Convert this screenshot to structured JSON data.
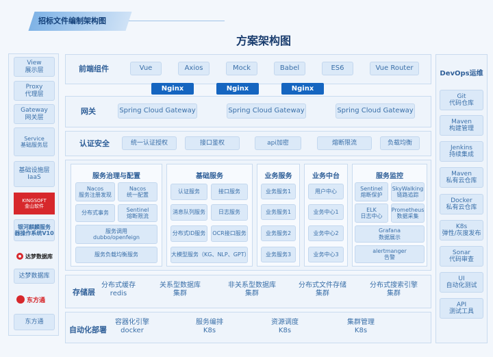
{
  "header": {
    "tab_title": "招标文件编制架构图",
    "main_title": "方案架构图"
  },
  "left_column": {
    "view": "View\n展示层",
    "proxy": "Proxy\n代理层",
    "gateway": "Gateway\n网关层",
    "service": "Service\n基础服务层",
    "iaas": "基础设施层\nIaaS",
    "kingsoft_logo": "KINGSOFT\n金山软件",
    "kylin_os": "银河麒麟服务\n器操作系统V10",
    "dameng_logo": "达梦数据库",
    "dameng": "达梦数据库",
    "dongfangtong_logo": "东方通",
    "dongfangtong": "东方通"
  },
  "frontend": {
    "label": "前端组件",
    "items": [
      "Vue",
      "Axios",
      "Mock",
      "Babel",
      "ES6",
      "Vue Router"
    ]
  },
  "nginx": [
    "Nginx",
    "Nginx",
    "Nginx"
  ],
  "gateway_row": {
    "label": "网关",
    "items": [
      "Spring Cloud Gateway",
      "Spring Cloud Gateway",
      "Spring Cloud Gateway"
    ]
  },
  "auth_row": {
    "label": "认证安全",
    "items": [
      "统一认证授权",
      "接口鉴权",
      "api加密",
      "熔断限流",
      "负载均衡"
    ]
  },
  "governance": {
    "title": "服务治理与配置",
    "items": [
      "Nacos\n服务注册发现",
      "Nacos\n统一配置",
      "分布式事务",
      "Sentinel\n熔断限流",
      "服务调用\ndubbo/openfeign",
      "服务负载均衡服务"
    ]
  },
  "basic": {
    "title": "基础服务",
    "items": [
      "认证服务",
      "接口服务",
      "消息队列服务",
      "日志服务",
      "分布式ID服务",
      "OCR接口服务",
      "大模型服务（KG、NLP、GPT）"
    ]
  },
  "business": {
    "title": "业务服务",
    "items": [
      "业务服务1",
      "业务服务1",
      "业务服务2",
      "业务服务3"
    ]
  },
  "middle": {
    "title": "业务中台",
    "items": [
      "用户中心",
      "业务中心1",
      "业务中心2",
      "业务中心3"
    ]
  },
  "monitor": {
    "title": "服务监控",
    "items": [
      "Sentinel\n熔断保护",
      "SkyWalking\n链路追踪",
      "ELK\n日志中心",
      "Prometheus\n数据采集",
      "Grafana\n数据展示",
      "alertmanger\n告警"
    ]
  },
  "storage": {
    "label": "存储层",
    "items": [
      "分布式缓存\nredis",
      "关系型数据库\n集群",
      "非关系型数据库\n集群",
      "分布式文件存储\n集群",
      "分布式搜索引擎\n集群"
    ]
  },
  "deploy": {
    "label": "自动化部署",
    "items": [
      "容器化引擎\ndocker",
      "服务编排\nK8s",
      "资源调度\nK8s",
      "集群管理\nK8s"
    ]
  },
  "devops": {
    "title": "DevOps运维",
    "items": [
      "Git\n代码仓库",
      "Maven\n构建管理",
      "Jenkins\n持续集成",
      "Maven\n私有云仓库",
      "Docker\n私有云仓库",
      "K8s\n弹性/灰度发布",
      "Sonar\n代码审查",
      "UI\n自动化测试",
      "API\n测试工具"
    ]
  },
  "colors": {
    "accent": "#1565c0",
    "box_fill": "#dbe9f8",
    "text": "#3a6fa8",
    "logo_red": "#d7282c"
  }
}
